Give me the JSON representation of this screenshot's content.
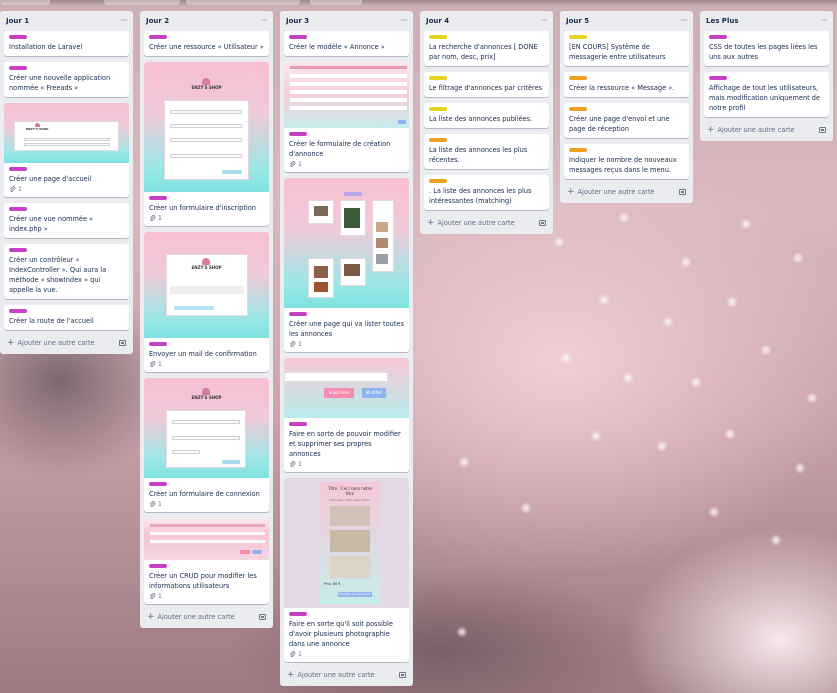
{
  "board": {
    "lists": [
      {
        "title": "Jour 1",
        "cards": [
          {
            "label_color": "#c840c8",
            "title": "Installation de Laravel"
          },
          {
            "label_color": "#c840c8",
            "title": "Créer une nouvelle application nommée « Freeads »"
          },
          {
            "label_color": "#c840c8",
            "title": "Créer une page d'accueil",
            "attachments": "1"
          },
          {
            "label_color": "#c840c8",
            "title": "Créer une vue nommée « index.php »"
          },
          {
            "label_color": "#c840c8",
            "title": "Créer un contrôleur « IndexController ». Qui aura la méthode « showIndex » qui appelle la vue."
          },
          {
            "label_color": "#c840c8",
            "title": "Créer la route de l'accueil"
          }
        ],
        "add_label": "Ajouter une autre carte"
      },
      {
        "title": "Jour 2",
        "cards": [
          {
            "label_color": "#c840c8",
            "title": "Créer une ressource « Utilisateur »"
          },
          {
            "label_color": "#c840c8",
            "title": "Créer un formulaire d'inscription",
            "attachments": "1"
          },
          {
            "label_color": "#c840c8",
            "title": "Envoyer un mail de confirmation",
            "attachments": "1"
          },
          {
            "label_color": "#c840c8",
            "title": "Créer un formulaire de connexion",
            "attachments": "1"
          },
          {
            "label_color": "#c840c8",
            "title": "Créer un CRUD pour modifier les informations utilisateurs",
            "attachments": "1"
          }
        ],
        "add_label": "Ajouter une autre carte"
      },
      {
        "title": "Jour 3",
        "cards": [
          {
            "label_color": "#c840c8",
            "title": "Créer le modèle « Annonce »"
          },
          {
            "label_color": "#c840c8",
            "title": "Créer le formulaire de création d'annonce",
            "attachments": "1"
          },
          {
            "label_color": "#c840c8",
            "title": "Créer une page qui va lister toutes les annonces",
            "attachments": "1"
          },
          {
            "label_color": "#c840c8",
            "title": "Faire en sorte de pouvoir modifier et supprimer ses propres annonces",
            "attachments": "1"
          },
          {
            "label_color": "#c840c8",
            "title": "Faire en sorte qu'il soit possible d'avoir plusieurs photographie dans une annonce",
            "attachments": "1"
          }
        ],
        "add_label": "Ajouter une autre carte"
      },
      {
        "title": "Jour 4",
        "cards": [
          {
            "label_color": "#e6d31e",
            "title": "La recherche d'annonces [ DONE par nom, desc, prix]"
          },
          {
            "label_color": "#e6d31e",
            "title": "Le filtrage d'annonces par critères"
          },
          {
            "label_color": "#e6d31e",
            "title": "La liste des annonces publiées."
          },
          {
            "label_color": "#f0a020",
            "title": "La liste des annonces les plus récentes."
          },
          {
            "label_color": "#f0a020",
            "title": ". La liste des annonces les plus intéressantes (matching)"
          }
        ],
        "add_label": "Ajouter une autre carte"
      },
      {
        "title": "Jour 5",
        "cards": [
          {
            "label_color": "#e6d31e",
            "title": "[EN COURS] Système de messagerie entre utilisateurs"
          },
          {
            "label_color": "#f0a020",
            "title": "Créer la ressource « Message »."
          },
          {
            "label_color": "#f0a020",
            "title": "Créer une page d'envoi et une page de réception"
          },
          {
            "label_color": "#f0a020",
            "title": "Indiquer le nombre de nouveaux messages reçus dans le menu."
          }
        ],
        "add_label": "Ajouter une autre carte"
      },
      {
        "title": "Les Plus",
        "cards": [
          {
            "label_color": "#c840c8",
            "title": "CSS de toutes les pages liées les uns aux autres"
          },
          {
            "label_color": "#c840c8",
            "title": "Affichage de tout les utilisateurs, mais modification uniquement de notre profil"
          }
        ],
        "add_label": "Ajouter une autre carte"
      }
    ],
    "mockups": {
      "shop_name": "ENZY'S SHOP",
      "delete_label": "Supprimer",
      "edit_label": "Modifier",
      "gallery_title": "Titre : Ceci sans notre titre",
      "gallery_desc": "Ceci avec notre description",
      "gallery_price": "Prix: 80 €",
      "gallery_button": "Modifier ou Supprimer"
    }
  }
}
